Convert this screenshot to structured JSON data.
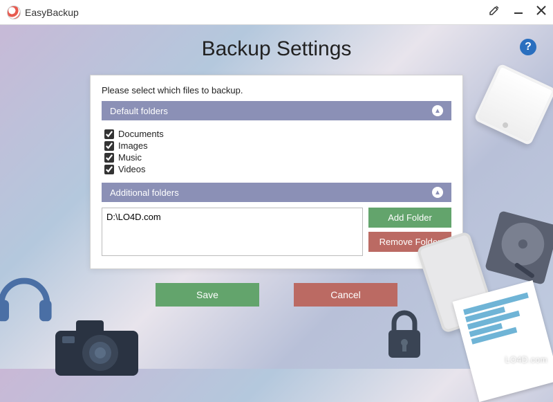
{
  "app": {
    "title": "EasyBackup"
  },
  "page": {
    "heading": "Backup Settings",
    "instruction": "Please select which files to backup."
  },
  "sections": {
    "defaults": {
      "title": "Default folders",
      "items": [
        {
          "label": "Documents",
          "checked": true
        },
        {
          "label": "Images",
          "checked": true
        },
        {
          "label": "Music",
          "checked": true
        },
        {
          "label": "Videos",
          "checked": true
        }
      ]
    },
    "additional": {
      "title": "Additional folders",
      "folders": [
        "D:\\LO4D.com"
      ],
      "add_label": "Add Folder",
      "remove_label": "Remove Folder"
    }
  },
  "buttons": {
    "save": "Save",
    "cancel": "Cancel"
  },
  "watermark": "LO4D.com",
  "colors": {
    "section_bar": "#8b90b6",
    "green": "#63a46c",
    "red": "#bb6a63",
    "help": "#2a6fbf"
  }
}
